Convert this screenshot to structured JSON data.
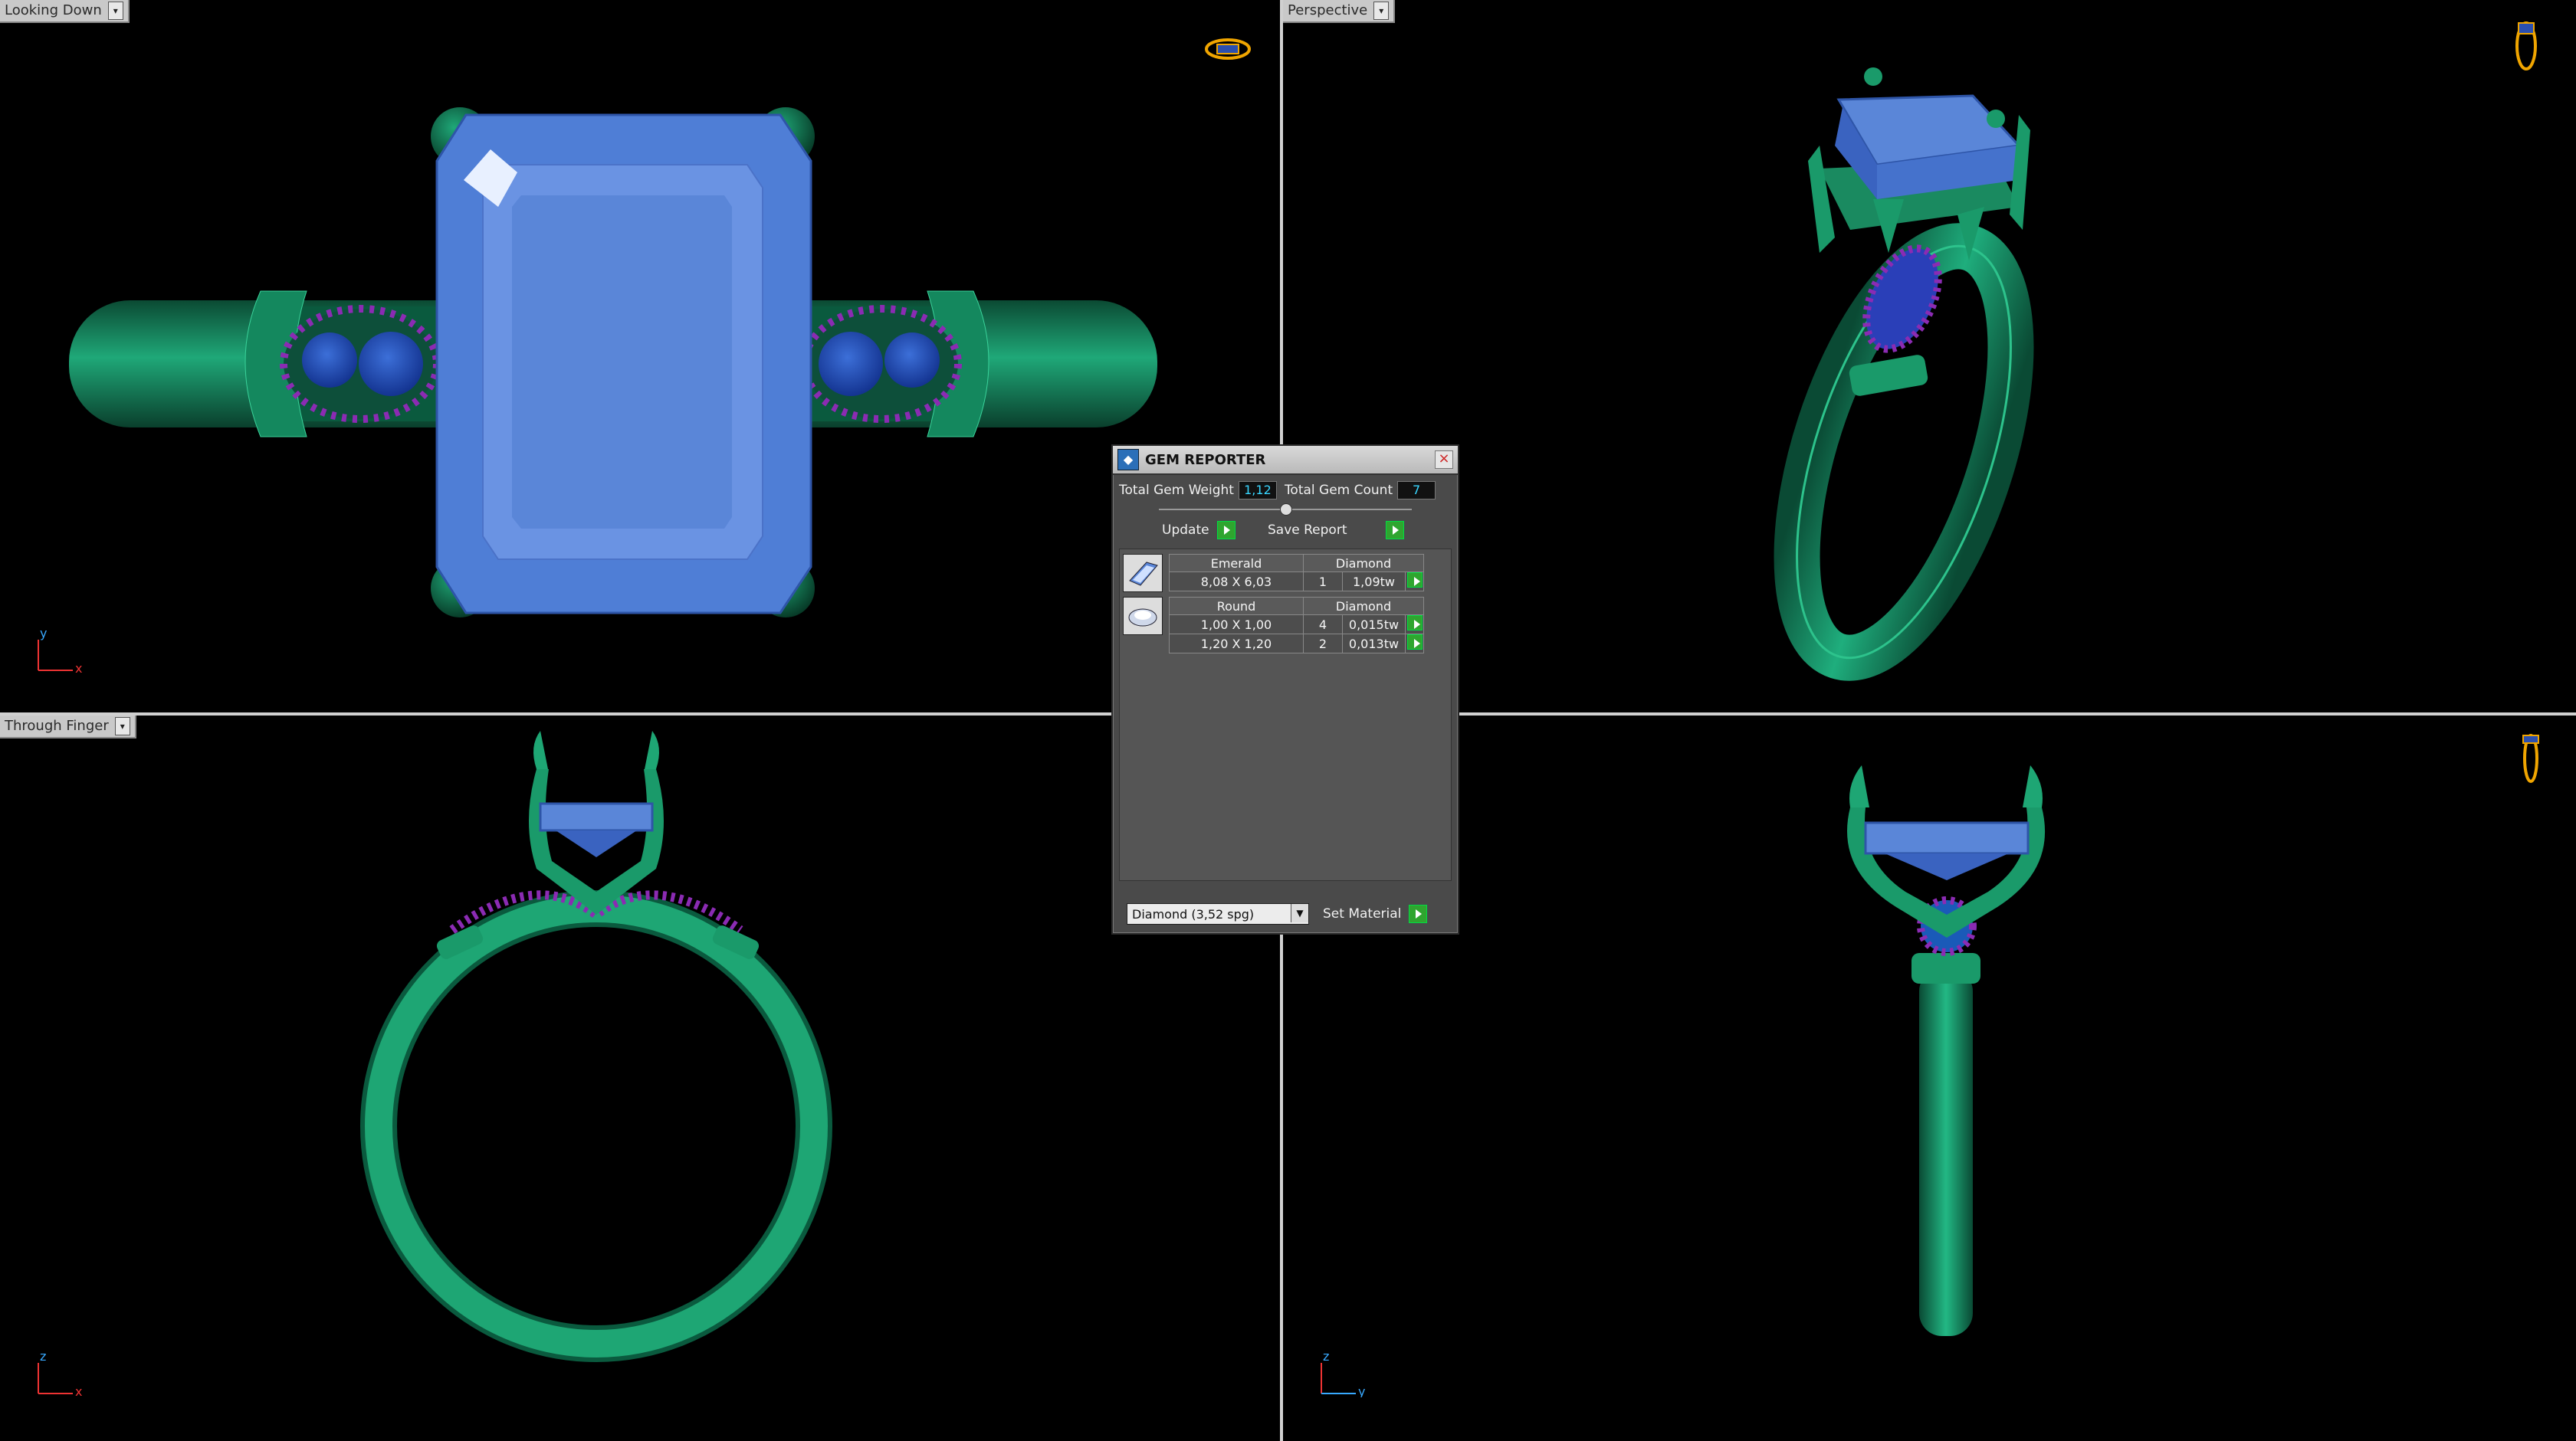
{
  "viewports": {
    "top_left": {
      "label": "Looking Down",
      "axis_v": "y",
      "axis_h": "x"
    },
    "top_right": {
      "label": "Perspective"
    },
    "bottom_left": {
      "label": "Through Finger",
      "axis_v": "z",
      "axis_h": "x"
    },
    "bottom_right": {
      "axis_v": "z",
      "axis_h": "y"
    }
  },
  "gem_reporter": {
    "title": "GEM REPORTER",
    "total_weight_label": "Total Gem Weight",
    "total_weight_value": "1,12",
    "total_count_label": "Total Gem Count",
    "total_count_value": "7",
    "update_label": "Update",
    "save_report_label": "Save Report",
    "groups": [
      {
        "icon": "emerald-cut-gem-icon",
        "shape": "Emerald",
        "material": "Diamond",
        "rows": [
          {
            "size": "8,08 X 6,03",
            "count": "1",
            "weight": "1,09tw"
          }
        ]
      },
      {
        "icon": "round-gem-icon",
        "shape": "Round",
        "material": "Diamond",
        "rows": [
          {
            "size": "1,00 X 1,00",
            "count": "4",
            "weight": "0,015tw"
          },
          {
            "size": "1,20 X 1,20",
            "count": "2",
            "weight": "0,013tw"
          }
        ]
      }
    ],
    "material_select_value": "Diamond    (3,52 spg)",
    "set_material_label": "Set Material"
  },
  "colors": {
    "metal": "#1a9a6a",
    "gem": "#5a86d8",
    "accent_stones": "#8b2bb3",
    "background": "#000000"
  }
}
